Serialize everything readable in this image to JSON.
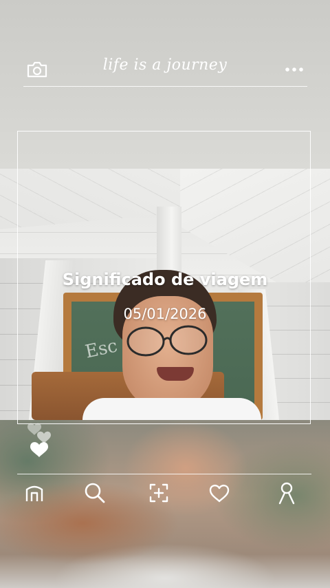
{
  "header": {
    "title": "life is a journey",
    "camera_icon": "camera-icon",
    "more_icon": "more-dots-icon"
  },
  "post": {
    "title": "Significado de viagem",
    "date": "05/01/2026",
    "hearts_icon": "hearts-icon"
  },
  "nav": {
    "items": [
      {
        "icon": "home-icon"
      },
      {
        "icon": "search-icon"
      },
      {
        "icon": "add-photo-icon"
      },
      {
        "icon": "heart-icon"
      },
      {
        "icon": "profile-icon"
      }
    ]
  },
  "colors": {
    "overlay_text": "#ffffff",
    "frame_line": "#ffffff"
  }
}
